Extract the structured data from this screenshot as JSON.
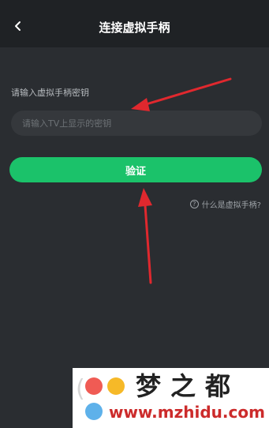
{
  "header": {
    "title": "连接虚拟手柄",
    "back_icon": "chevron-left-icon"
  },
  "form": {
    "section_label": "请输入虚拟手柄密钥",
    "input_placeholder": "请输入TV上显示的密钥",
    "input_value": "",
    "verify_label": "验证"
  },
  "help": {
    "icon": "question-circle-icon",
    "label": "什么是虚拟手柄?"
  },
  "annotations": {
    "arrow_color": "#e0282e"
  },
  "watermark": {
    "title": "梦之都",
    "url": "www.mzhidu.com"
  },
  "colors": {
    "background": "#2a2d31",
    "topbar": "#1f2225",
    "accent": "#1bc26a",
    "input_bg": "#35383c"
  }
}
